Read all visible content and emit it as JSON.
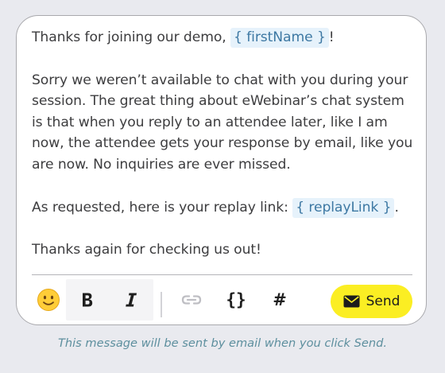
{
  "message": {
    "greeting_prefix": "Thanks for joining our demo, ",
    "first_name_token": "{ firstName }",
    "greeting_suffix": "!",
    "body": "Sorry we weren’t available to chat with you during your session. The great thing about eWebinar’s chat system is that when you reply to an attendee later, like I am now, the attendee gets your response by email, like you are now. No inquiries are ever missed.",
    "replay_prefix": "As requested, here is your replay link: ",
    "replay_link_token": "{ replayLink }",
    "replay_suffix": ".",
    "closing": "Thanks again for checking us out!"
  },
  "toolbar": {
    "emoji_icon": "slightly-smiling-face",
    "bold_label": "B",
    "italic_label": "I",
    "link_icon": "link",
    "merge_tag_label": "{}",
    "hashtag_label": "#",
    "send_label": "Send",
    "send_icon": "envelope"
  },
  "helper_text": "This message will be sent by email when you click Send.",
  "colors": {
    "page_bg": "#e9eaef",
    "send_button": "#fbee23",
    "token_bg": "#e6f2fb",
    "token_text": "#3d78a3",
    "helper_text": "#5d8f9e"
  }
}
